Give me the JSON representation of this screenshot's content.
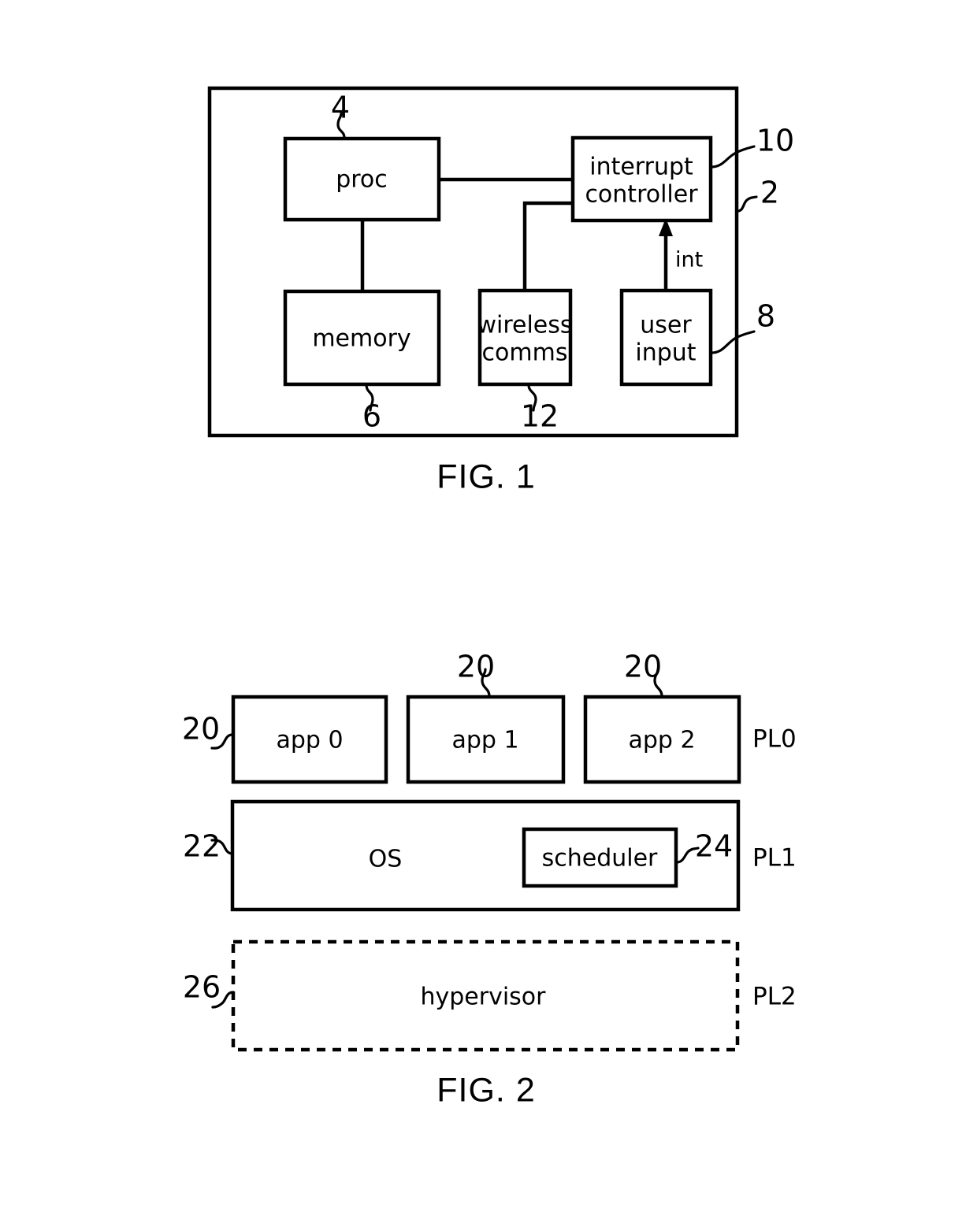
{
  "figures": [
    {
      "caption": "FIG. 1",
      "frame_ref": "2",
      "blocks": [
        {
          "label": "proc",
          "ref": "4"
        },
        {
          "label": "interrupt controller",
          "line1": "interrupt",
          "line2": "controller",
          "ref": "10"
        },
        {
          "label": "memory",
          "ref": "6"
        },
        {
          "label": "wireless comms",
          "line1": "wireless",
          "line2": "comms",
          "ref": "12"
        },
        {
          "label": "user input",
          "line1": "user",
          "line2": "input",
          "ref": "8"
        }
      ],
      "signals": [
        {
          "label": "int",
          "from": "user input",
          "to": "interrupt controller"
        }
      ]
    },
    {
      "caption": "FIG. 2",
      "privilege_levels": [
        "PL0",
        "PL1",
        "PL2"
      ],
      "rows": [
        {
          "level": "PL0",
          "blocks": [
            {
              "label": "app 0",
              "ref": "20"
            },
            {
              "label": "app 1",
              "ref": "20"
            },
            {
              "label": "app 2",
              "ref": "20"
            }
          ]
        },
        {
          "level": "PL1",
          "blocks": [
            {
              "label": "OS",
              "ref": "22"
            },
            {
              "label": "scheduler",
              "ref": "24"
            }
          ]
        },
        {
          "level": "PL2",
          "blocks": [
            {
              "label": "hypervisor",
              "ref": "26",
              "border": "dashed"
            }
          ]
        }
      ]
    }
  ],
  "fig1": {
    "caption": "FIG. 1",
    "frame_ref": "2",
    "proc": {
      "label": "proc",
      "ref": "4"
    },
    "interrupt_controller": {
      "line1": "interrupt",
      "line2": "controller",
      "ref": "10"
    },
    "memory": {
      "label": "memory",
      "ref": "6"
    },
    "wireless_comms": {
      "line1": "wireless",
      "line2": "comms",
      "ref": "12"
    },
    "user_input": {
      "line1": "user",
      "line2": "input",
      "ref": "8"
    },
    "int_signal": {
      "label": "int"
    }
  },
  "fig2": {
    "caption": "FIG. 2",
    "app0": {
      "label": "app 0",
      "ref": "20"
    },
    "app1": {
      "label": "app 1",
      "ref": "20"
    },
    "app2": {
      "label": "app 2",
      "ref": "20"
    },
    "os": {
      "label": "OS",
      "ref": "22"
    },
    "scheduler": {
      "label": "scheduler",
      "ref": "24"
    },
    "hypervisor": {
      "label": "hypervisor",
      "ref": "26"
    },
    "pl0": "PL0",
    "pl1": "PL1",
    "pl2": "PL2"
  },
  "colors": {
    "stroke": "#000000",
    "background": "#ffffff"
  }
}
